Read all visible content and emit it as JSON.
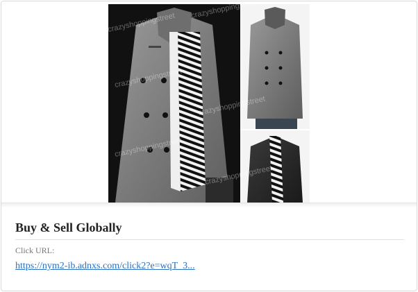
{
  "card": {
    "title": "Buy & Sell Globally",
    "click_url_label": "Click URL:",
    "click_url": "https://nym2-ib.adnxs.com/click2?e=wqT_3..."
  },
  "image": {
    "watermark": "crazyshoppingstreet",
    "subject": "product-photo-grey-coat"
  },
  "colors": {
    "link": "#2a6fc2",
    "title": "#222222",
    "background": "#ffffff"
  }
}
